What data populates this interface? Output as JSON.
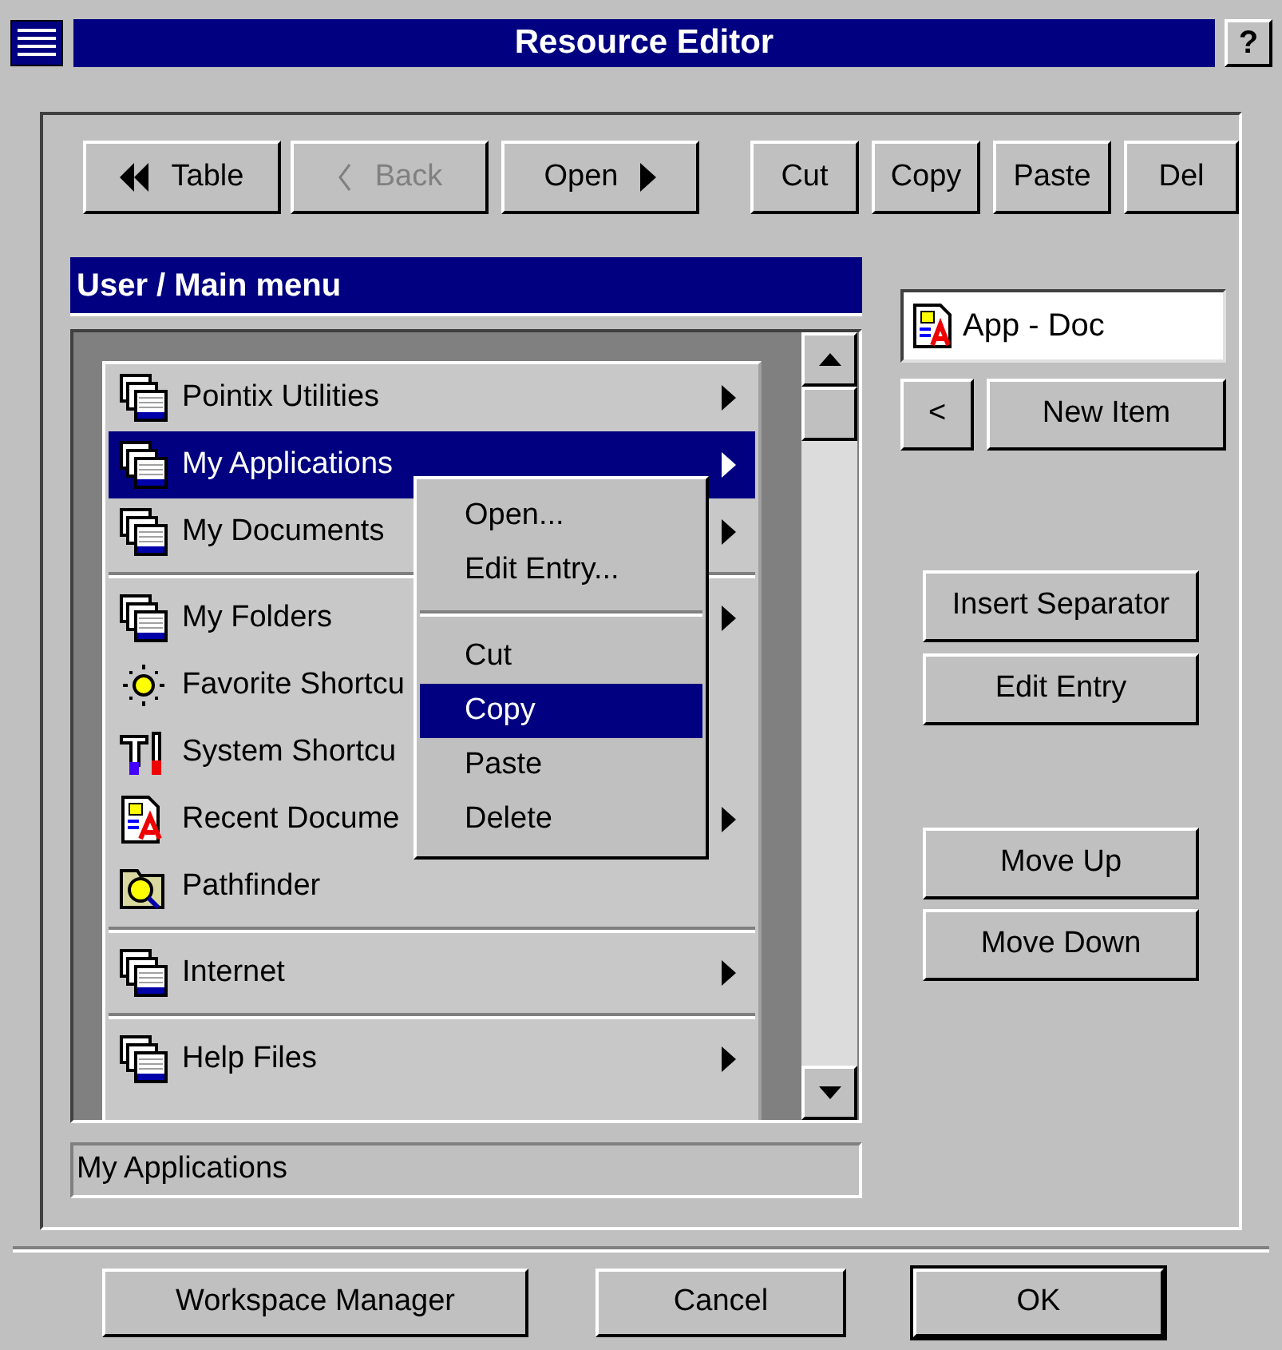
{
  "window": {
    "title": "Resource Editor",
    "help": "?"
  },
  "toolbar": [
    {
      "label": "Table",
      "kind": "rewind",
      "disabled": false
    },
    {
      "label": "Back",
      "kind": "back",
      "disabled": true
    },
    {
      "label": "Open",
      "kind": "forward",
      "disabled": false
    },
    {
      "label": "Cut",
      "kind": "plain",
      "disabled": false
    },
    {
      "label": "Copy",
      "kind": "plain",
      "disabled": false
    },
    {
      "label": "Paste",
      "kind": "plain",
      "disabled": false
    },
    {
      "label": "Del",
      "kind": "plain",
      "disabled": false
    }
  ],
  "panel_title": "User / Main menu",
  "menu_items": [
    {
      "kind": "windows",
      "label": "Pointix Utilities",
      "submenu": true,
      "selected": false
    },
    {
      "kind": "windows",
      "label": "My Applications",
      "submenu": true,
      "selected": true
    },
    {
      "kind": "windows",
      "label": "My Documents",
      "submenu": true,
      "selected": false
    },
    {
      "kind": "separator"
    },
    {
      "kind": "windows",
      "label": "My Folders",
      "submenu": true,
      "selected": false
    },
    {
      "kind": "sun",
      "label": "Favorite Shortcu",
      "submenu": false,
      "selected": false
    },
    {
      "kind": "tools",
      "label": "System Shortcu",
      "submenu": false,
      "selected": false
    },
    {
      "kind": "document",
      "label": "Recent Docume",
      "submenu": true,
      "selected": false
    },
    {
      "kind": "finder",
      "label": "Pathfinder",
      "submenu": false,
      "selected": false
    },
    {
      "kind": "separator"
    },
    {
      "kind": "windows",
      "label": "Internet",
      "submenu": true,
      "selected": false
    },
    {
      "kind": "separator"
    },
    {
      "kind": "windows",
      "label": "Help Files",
      "submenu": true,
      "selected": false
    }
  ],
  "context_menu": [
    {
      "kind": "item",
      "label": "Open...",
      "selected": false
    },
    {
      "kind": "item",
      "label": "Edit Entry...",
      "selected": false
    },
    {
      "kind": "separator"
    },
    {
      "kind": "item",
      "label": "Cut",
      "selected": false
    },
    {
      "kind": "item",
      "label": "Copy",
      "selected": true
    },
    {
      "kind": "item",
      "label": "Paste",
      "selected": false
    },
    {
      "kind": "item",
      "label": "Delete",
      "selected": false
    }
  ],
  "status_field": "My Applications",
  "entry_field": {
    "value": "App - Doc"
  },
  "entry_buttons": [
    "<",
    "New Item"
  ],
  "side_buttons": [
    "Insert Separator",
    "Edit Entry",
    "Move Up",
    "Move Down"
  ],
  "footer_buttons": [
    {
      "label": "Workspace Manager",
      "default": false
    },
    {
      "label": "Cancel",
      "default": false
    },
    {
      "label": "OK",
      "default": true
    }
  ]
}
